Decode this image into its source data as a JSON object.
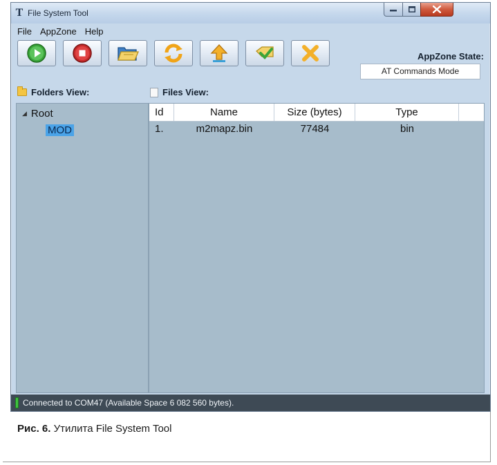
{
  "window": {
    "title": "File System Tool",
    "app_icon": "T"
  },
  "menu": {
    "items": [
      "File",
      "AppZone",
      "Help"
    ]
  },
  "toolbar": {
    "buttons": [
      {
        "icon": "play-icon"
      },
      {
        "icon": "stop-icon"
      },
      {
        "icon": "open-folder-icon"
      },
      {
        "icon": "refresh-icon"
      },
      {
        "icon": "upload-icon"
      },
      {
        "icon": "transfer-icon"
      },
      {
        "icon": "delete-icon"
      }
    ]
  },
  "appzone_state": {
    "label": "AppZone State:",
    "value": "AT Commands Mode"
  },
  "folders_view": {
    "label": "Folders View:",
    "root": "Root",
    "children": [
      "MOD"
    ]
  },
  "files_view": {
    "label": "Files View:",
    "columns": [
      "Id",
      "Name",
      "Size (bytes)",
      "Type"
    ],
    "rows": [
      {
        "id": "1.",
        "name": "m2mapz.bin",
        "size": "77484",
        "type": "bin"
      }
    ]
  },
  "status": {
    "text": "Connected to COM47 (Available Space 6 082 560 bytes)."
  },
  "caption": {
    "prefix": "Рис. 6.",
    "text": " Утилита File System Tool"
  },
  "colors": {
    "window_bg": "#c6d8ea",
    "panel_bg": "#a7bccb",
    "statusbar_bg": "#3e4a55",
    "status_led": "#3fc43f",
    "selection": "#4aa3e8"
  }
}
